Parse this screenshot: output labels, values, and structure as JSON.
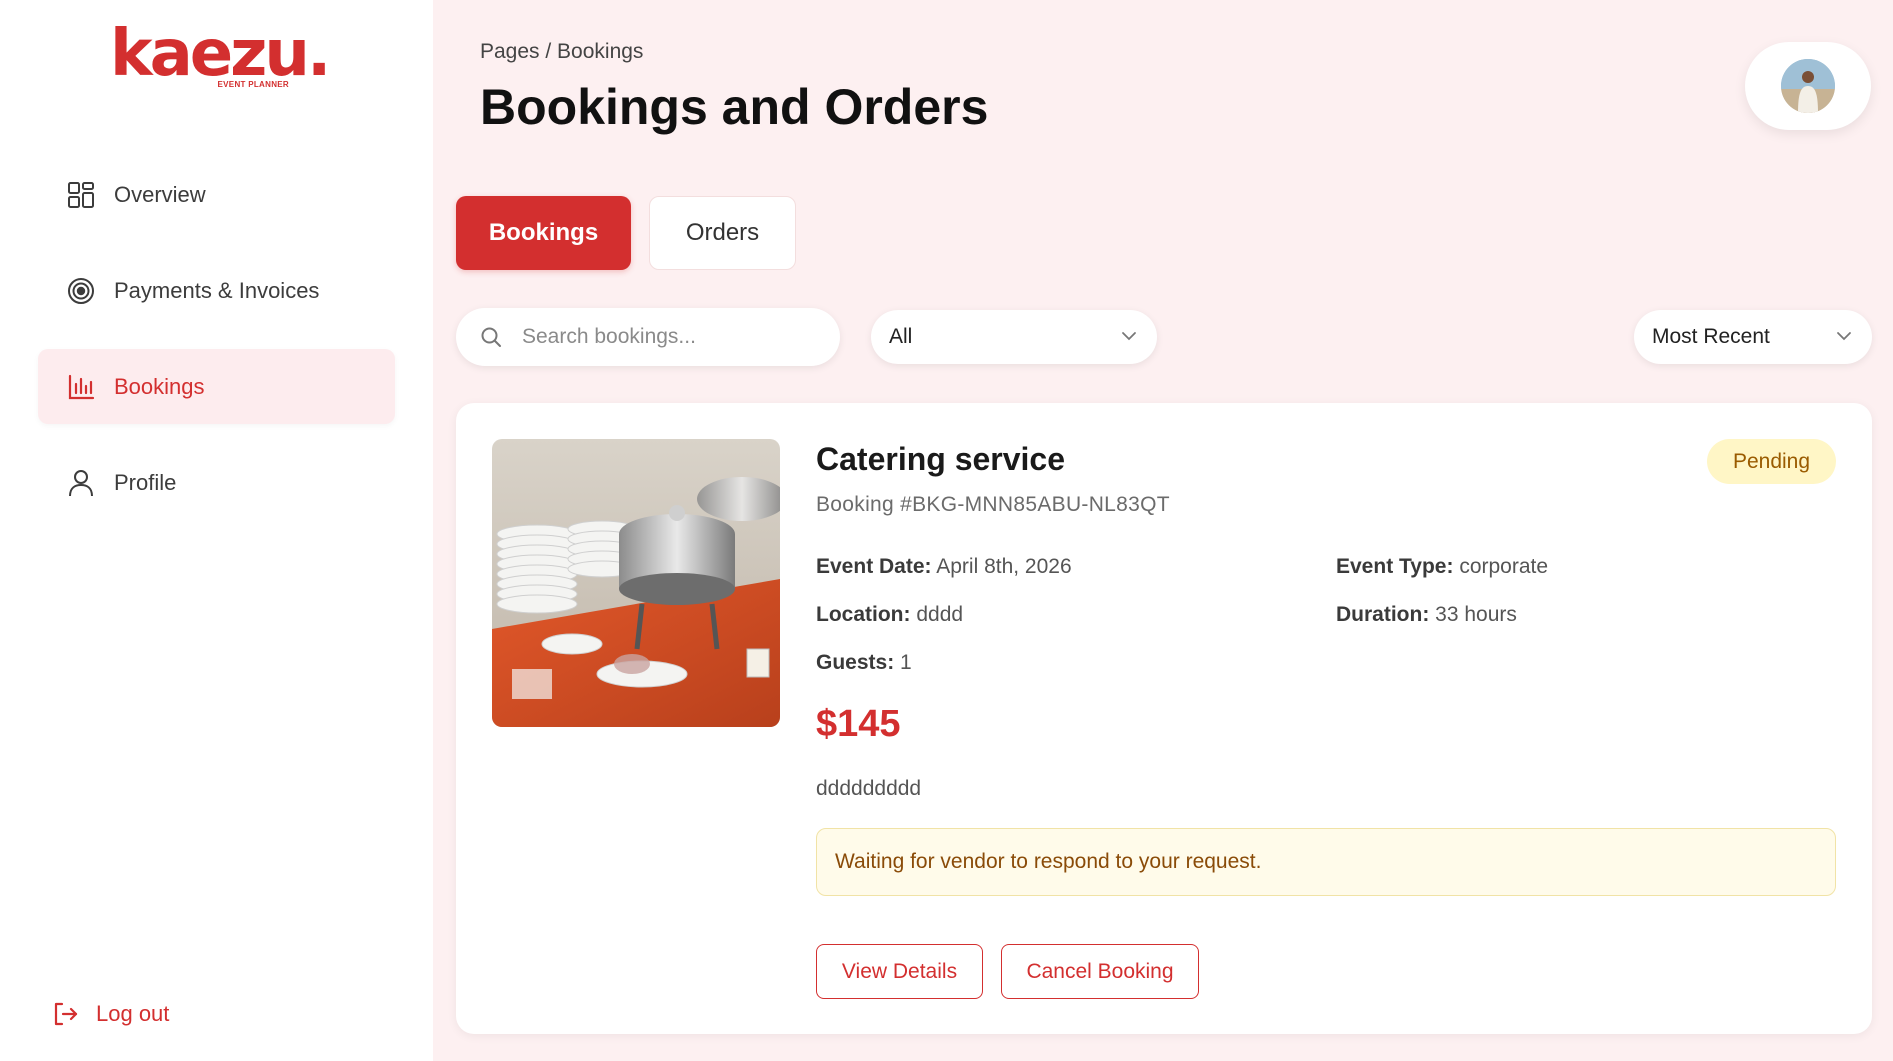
{
  "brand": {
    "name": "kaezu.",
    "tagline": "EVENT PLANNER"
  },
  "sidebar": {
    "items": [
      {
        "label": "Overview",
        "icon": "grid-icon",
        "active": false
      },
      {
        "label": "Payments & Invoices",
        "icon": "target-icon",
        "active": false
      },
      {
        "label": "Bookings",
        "icon": "bar-chart-icon",
        "active": true
      },
      {
        "label": "Profile",
        "icon": "user-icon",
        "active": false
      }
    ],
    "logout_label": "Log out"
  },
  "header": {
    "breadcrumb": "Pages / Bookings",
    "title": "Bookings and Orders"
  },
  "tabs": [
    {
      "label": "Bookings",
      "active": true
    },
    {
      "label": "Orders",
      "active": false
    }
  ],
  "filters": {
    "search_placeholder": "Search bookings...",
    "search_value": "",
    "status_value": "All",
    "sort_value": "Most Recent"
  },
  "booking": {
    "title": "Catering service",
    "id_text": "Booking #BKG-MNN85ABU-NL83QT",
    "status": "Pending",
    "fields": {
      "event_date_label": "Event Date:",
      "event_date_value": "April 8th, 2026",
      "event_type_label": "Event Type:",
      "event_type_value": "corporate",
      "location_label": "Location:",
      "location_value": "dddd",
      "duration_label": "Duration:",
      "duration_value": "33 hours",
      "guests_label": "Guests:",
      "guests_value": "1"
    },
    "price": "$145",
    "description": "ddddddddd",
    "notice": "Waiting for vendor to respond to your request.",
    "view_label": "View Details",
    "cancel_label": "Cancel Booking"
  },
  "colors": {
    "accent": "#d32f2f",
    "page_bg": "#fdf0f1",
    "pending_bg": "#fff6c6",
    "pending_text": "#9a5b00",
    "notice_bg": "#fffbea"
  }
}
